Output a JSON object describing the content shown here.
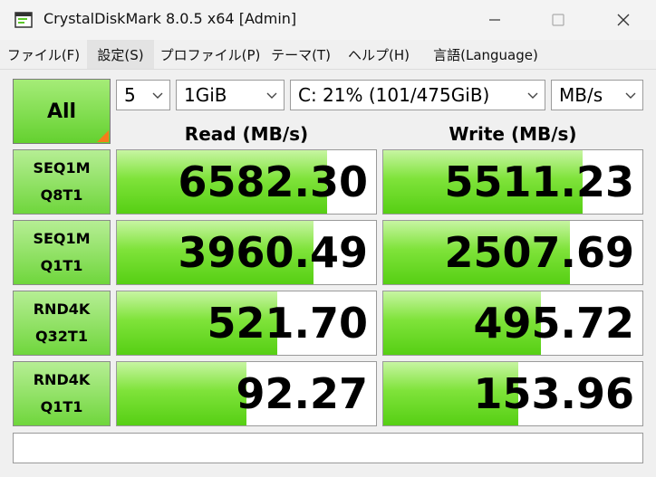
{
  "window": {
    "title": "CrystalDiskMark 8.0.5 x64 [Admin]",
    "minimize_glyph": "—",
    "maximize_glyph": "☐",
    "close_glyph": "✕"
  },
  "menu": [
    {
      "label": "ファイル(F)"
    },
    {
      "label": "設定(S)"
    },
    {
      "label": "プロファイル(P)"
    },
    {
      "label": "テーマ(T)"
    },
    {
      "label": "ヘルプ(H)"
    },
    {
      "label": "言語(Language)"
    }
  ],
  "controls": {
    "all_label": "All",
    "count_value": "5",
    "size_value": "1GiB",
    "drive_value": "C: 21% (101/475GiB)",
    "unit_value": "MB/s"
  },
  "headers": {
    "read": "Read (MB/s)",
    "write": "Write (MB/s)"
  },
  "rows": [
    {
      "label1": "SEQ1M",
      "label2": "Q8T1",
      "read": "6582.30",
      "write": "5511.23",
      "read_fill": 0.81,
      "write_fill": 0.77
    },
    {
      "label1": "SEQ1M",
      "label2": "Q1T1",
      "read": "3960.49",
      "write": "2507.69",
      "read_fill": 0.76,
      "write_fill": 0.72
    },
    {
      "label1": "RND4K",
      "label2": "Q32T1",
      "read": "521.70",
      "write": "495.72",
      "read_fill": 0.62,
      "write_fill": 0.61
    },
    {
      "label1": "RND4K",
      "label2": "Q1T1",
      "read": "92.27",
      "write": "153.96",
      "read_fill": 0.5,
      "write_fill": 0.52
    }
  ],
  "status_text": "",
  "colors": {
    "accent_green": "#6fd63c",
    "corner_orange": "#f57c1a"
  }
}
